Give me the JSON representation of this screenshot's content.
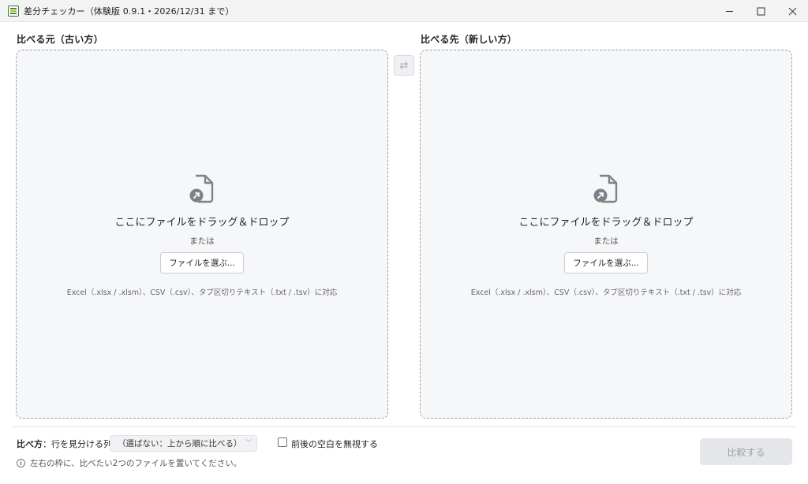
{
  "window": {
    "title": "差分チェッカー（体験版 0.9.1・2026/12/31 まで）"
  },
  "left_panel": {
    "label": "比べる元（古い方）",
    "drop_text": "ここにファイルをドラッグ＆ドロップ",
    "or_text": "または",
    "choose_button": "ファイルを選ぶ...",
    "hint": "Excel（.xlsx / .xlsm）、CSV（.csv）、タブ区切りテキスト（.txt / .tsv）に対応"
  },
  "right_panel": {
    "label": "比べる先（新しい方）",
    "drop_text": "ここにファイルをドラッグ＆ドロップ",
    "or_text": "または",
    "choose_button": "ファイルを選ぶ...",
    "hint": "Excel（.xlsx / .xlsm）、CSV（.csv）、タブ区切りテキスト（.txt / .tsv）に対応"
  },
  "swap_button": {
    "glyph": "⇄"
  },
  "footer": {
    "method_label": "比べ方",
    "key_label": "：行を見分ける列",
    "key_select_value": "（選ばない：上から順に比べる）",
    "ignore_whitespace_label": "前後の空白を無視する",
    "ignore_whitespace_checked": false,
    "hint": "左右の枠に、比べたい2つのファイルを置いてください。",
    "compare_button": "比較する",
    "compare_enabled": false
  },
  "icons": {
    "app": "spreadsheet-app-icon",
    "file": "file-arrow-icon",
    "info": "info-icon",
    "minimize": "minimize-icon",
    "maximize": "maximize-icon",
    "close": "close-icon",
    "swap": "swap-icon"
  },
  "colors": {
    "dropzone_bg": "#f6f7f9",
    "dropzone_border": "#9aa0a8",
    "icon_gray": "#7d838b",
    "disabled_button_bg": "#e4e6ea",
    "disabled_button_text": "#9ea3aa"
  }
}
